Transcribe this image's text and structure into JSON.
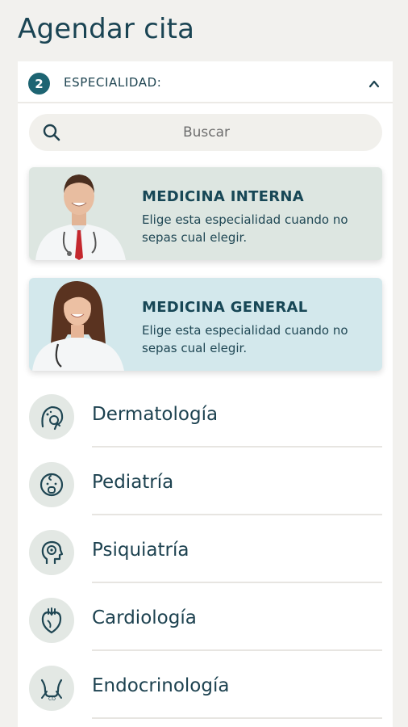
{
  "page": {
    "title": "Agendar cita"
  },
  "step": {
    "number": "2",
    "label": "ESPECIALIDAD:",
    "toggle_icon": "chevron-up-icon"
  },
  "search": {
    "icon": "search-icon",
    "placeholder": "Buscar"
  },
  "featured": [
    {
      "title": "MEDICINA INTERNA",
      "description": "Elige esta especialidad cuando no sepas cual elegir.",
      "photo": "male-doctor-photo",
      "background": "#dde6e1"
    },
    {
      "title": "MEDICINA GENERAL",
      "description": "Elige esta especialidad cuando no sepas cual elegir.",
      "photo": "female-doctor-photo",
      "background": "#d3e8ec"
    }
  ],
  "specialties": [
    {
      "label": "Dermatología",
      "icon": "dermatology-icon"
    },
    {
      "label": "Pediatría",
      "icon": "baby-icon"
    },
    {
      "label": "Psiquiatría",
      "icon": "head-brain-icon"
    },
    {
      "label": "Cardiología",
      "icon": "heart-icon"
    },
    {
      "label": "Endocrinología",
      "icon": "thyroid-icon"
    }
  ],
  "colors": {
    "accent": "#1d6472",
    "text": "#1d4250",
    "background": "#f2f1ee"
  }
}
